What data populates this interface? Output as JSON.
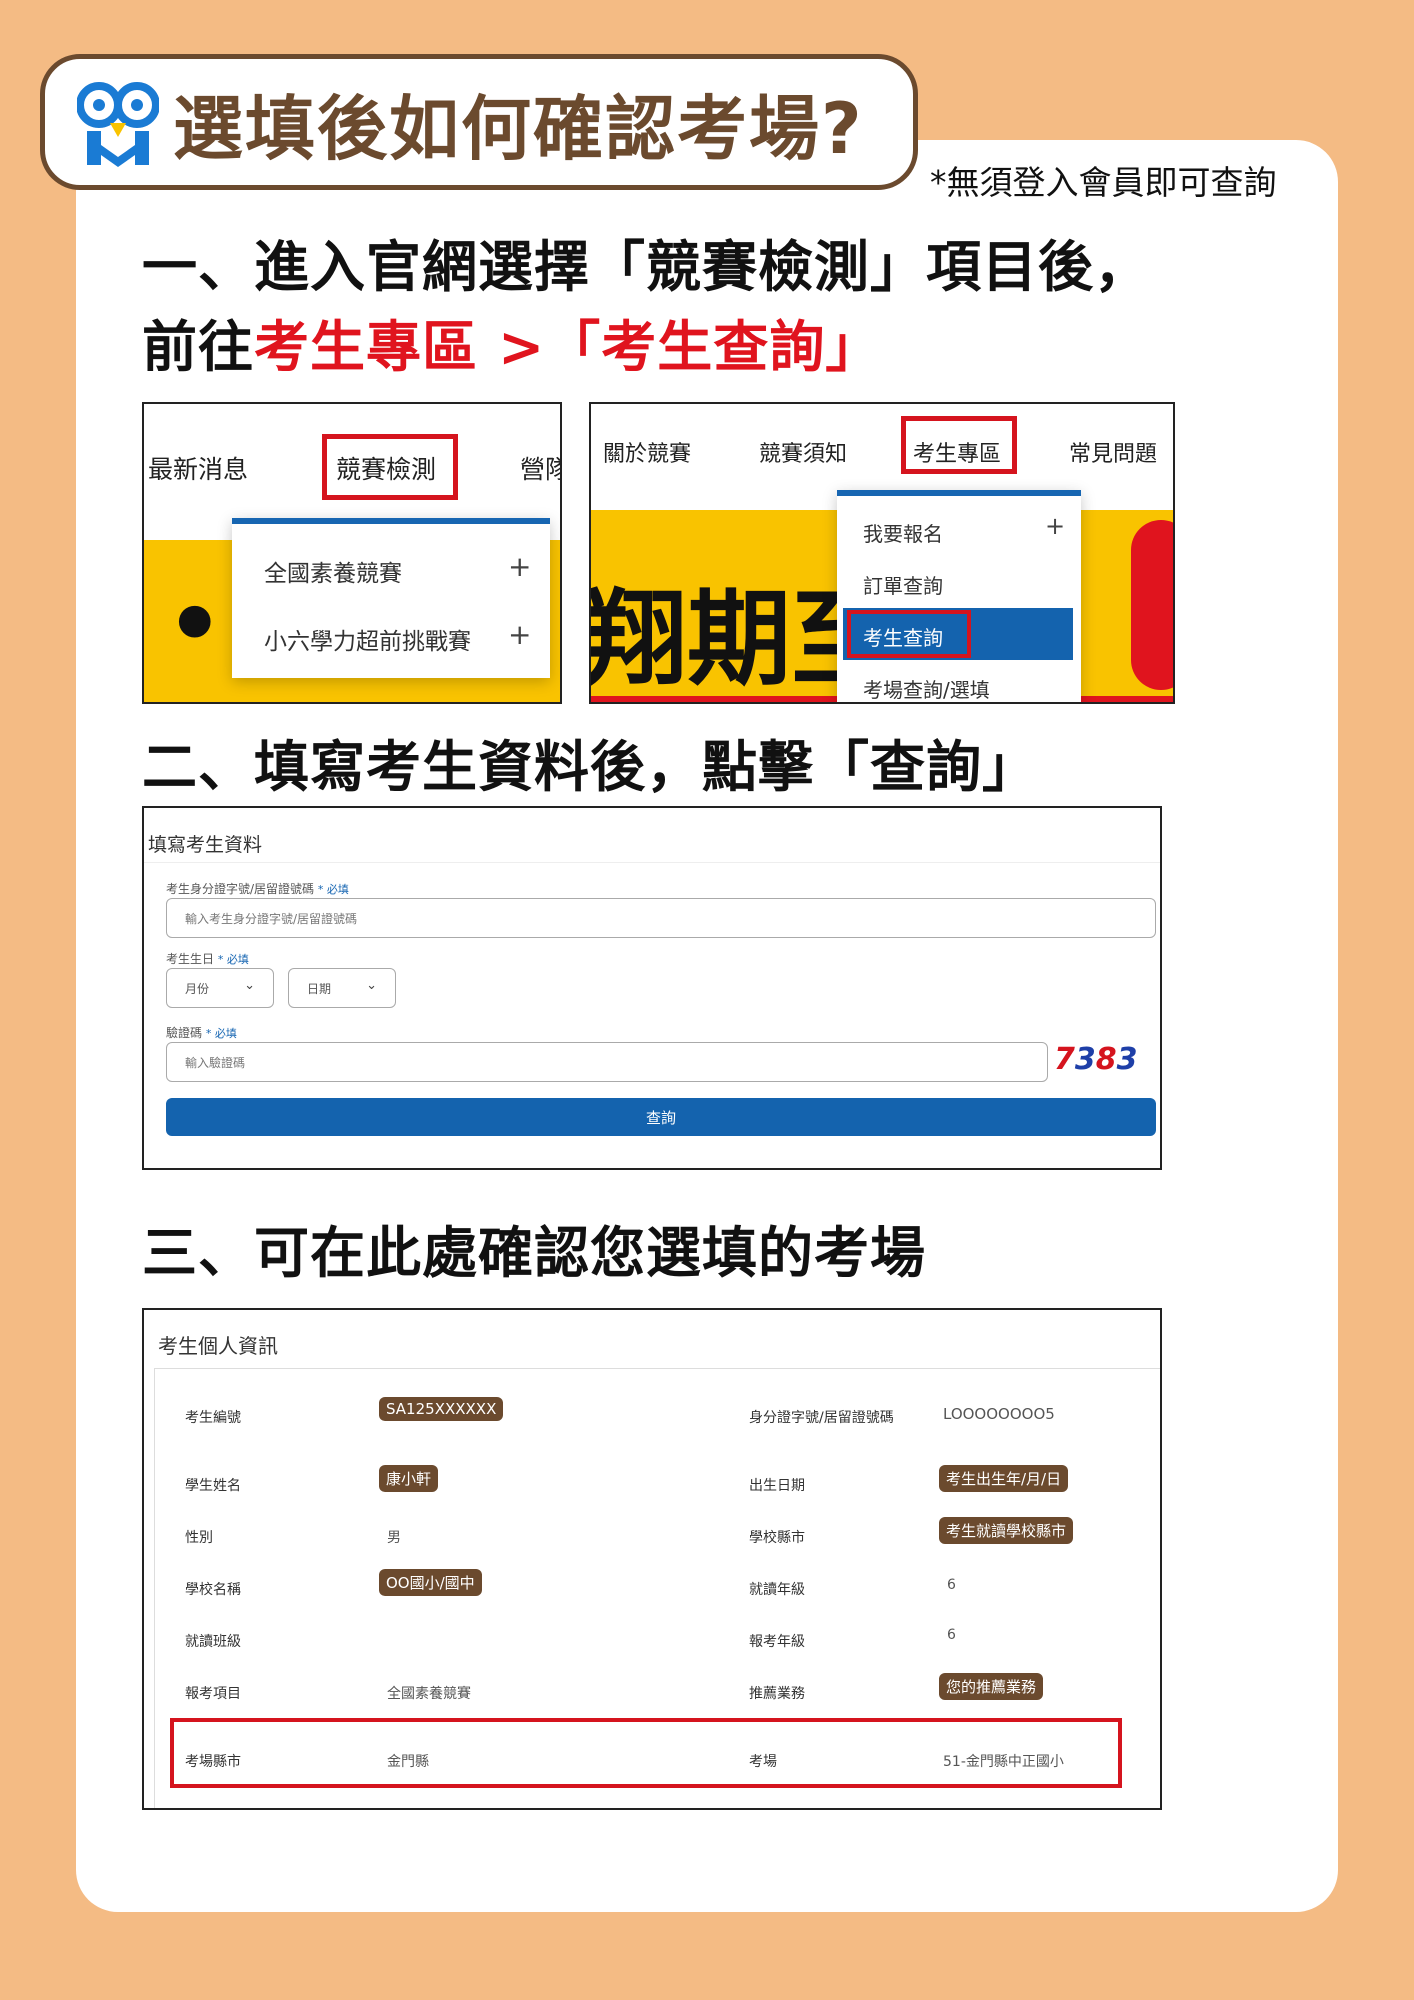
{
  "header": {
    "title": "選填後如何確認考場?",
    "note": "*無須登入會員即可查詢"
  },
  "step1": {
    "line1": "一、進入官網選擇「競賽檢測」項目後，",
    "line2_prefix": "前往",
    "line2_red": "考生專區 >「考生查詢」"
  },
  "screenshot1": {
    "nav": [
      "最新消息",
      "競賽檢測",
      "營隊"
    ],
    "dropdown": [
      "全國素養競賽",
      "小六學力超前挑戰賽"
    ],
    "plus": "+",
    "banner_text": "•"
  },
  "screenshot2": {
    "nav": [
      "關於競賽",
      "競賽須知",
      "考生專區",
      "常見問題"
    ],
    "dropdown": [
      "我要報名",
      "訂單查詢",
      "考生查詢",
      "考場查詢/選填"
    ],
    "plus": "+",
    "banner_text": "翔期至"
  },
  "step2": {
    "heading": "二、填寫考生資料後，點擊「查詢」"
  },
  "form": {
    "title": "填寫考生資料",
    "required": "* 必填",
    "id_label": "考生身分證字號/居留證號碼",
    "id_placeholder": "輸入考生身分證字號/居留證號碼",
    "birthday_label": "考生生日",
    "month_placeholder": "月份",
    "day_placeholder": "日期",
    "captcha_label": "驗證碼",
    "captcha_placeholder": "輸入驗證碼",
    "captcha_chars": [
      "7",
      "3",
      "8",
      "3"
    ],
    "captcha_colors": [
      "#D5141E",
      "#1E3FA8",
      "#D5141E",
      "#1E3FA8"
    ],
    "submit_label": "查詢"
  },
  "step3": {
    "heading": "三、可在此處確認您選填的考場"
  },
  "profile": {
    "title": "考生個人資訊",
    "fields": {
      "exam_no_label": "考生編號",
      "exam_no_value": "SA125XXXXXX",
      "id_label": "身分證字號/居留證號碼",
      "id_value": "LOOOOOOOO5",
      "name_label": "學生姓名",
      "name_value": "康小軒",
      "birth_label": "出生日期",
      "birth_value": "考生出生年/月/日",
      "gender_label": "性別",
      "gender_value": "男",
      "school_county_label": "學校縣市",
      "school_county_value": "考生就讀學校縣市",
      "school_name_label": "學校名稱",
      "school_name_value": "OO國小/國中",
      "grade_label": "就讀年級",
      "grade_value": "6",
      "class_label": "就讀班級",
      "class_value": "",
      "exam_grade_label": "報考年級",
      "exam_grade_value": "6",
      "exam_item_label": "報考項目",
      "exam_item_value": "全國素養競賽",
      "referral_label": "推薦業務",
      "referral_value": "您的推薦業務",
      "venue_county_label": "考場縣市",
      "venue_county_value": "金門縣",
      "venue_label": "考場",
      "venue_value": "51-金門縣中正國小"
    }
  },
  "colors": {
    "background": "#F4BB84",
    "brown": "#6B4A2E",
    "red": "#E0141E",
    "blue": "#1766B2",
    "yellow": "#F9C300"
  }
}
